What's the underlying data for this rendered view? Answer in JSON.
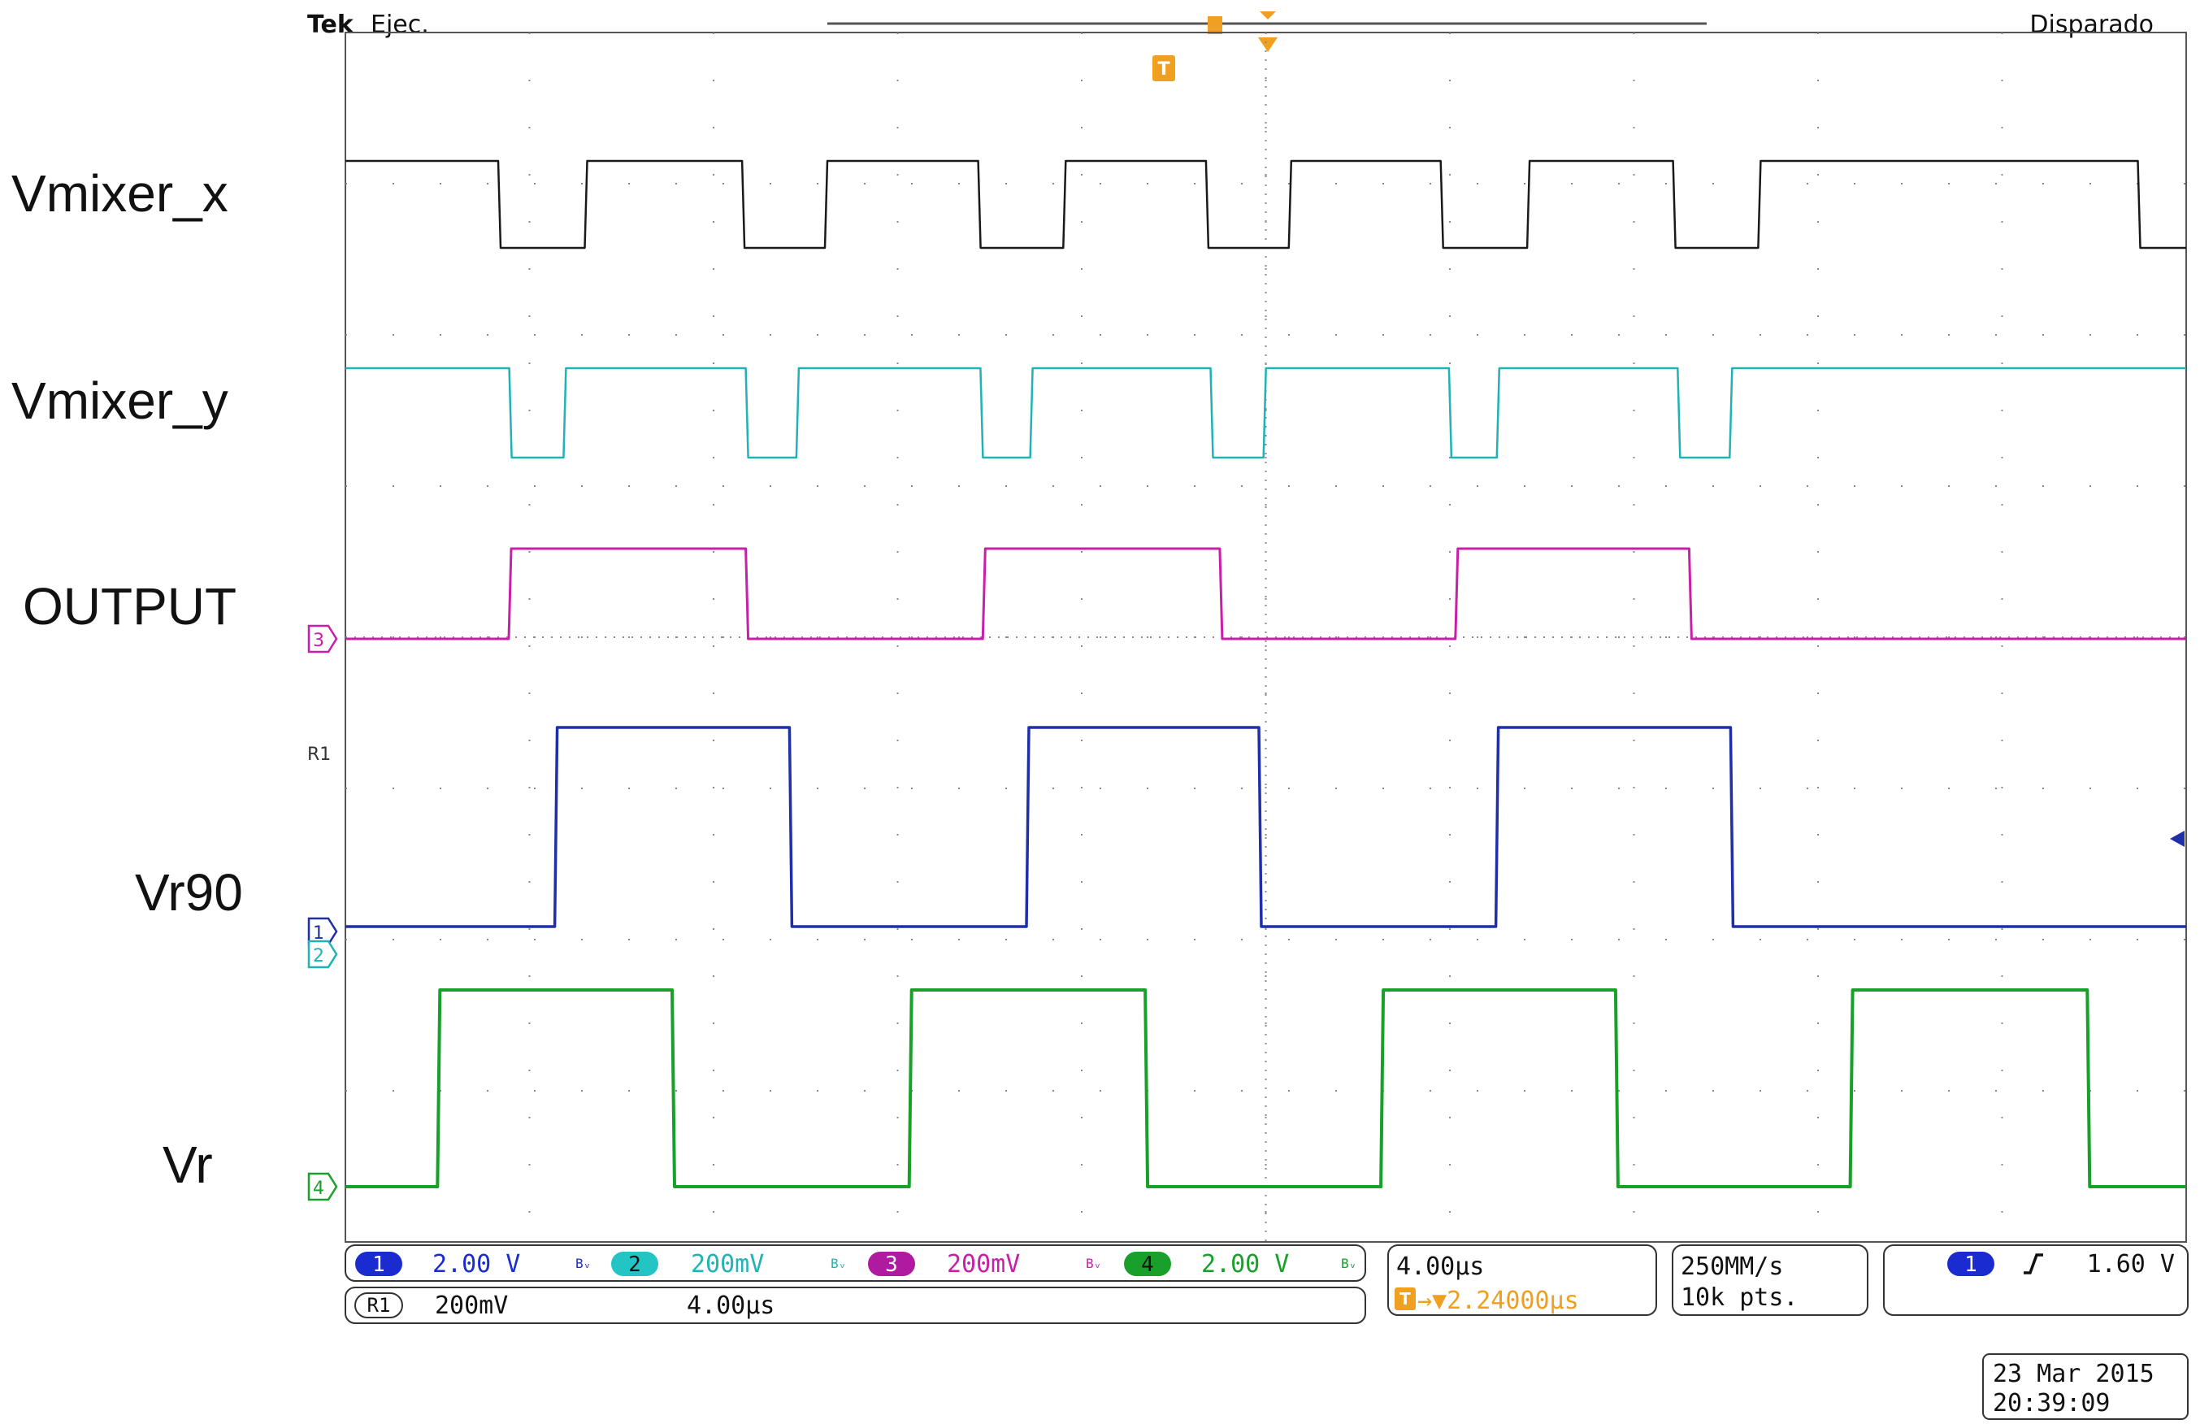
{
  "header": {
    "brand": "Tek",
    "run_state": "Ejec.",
    "trigger_status": "Disparado"
  },
  "side_labels": [
    "Vmixer_x",
    "Vmixer_y",
    "OUTPUT",
    "Vr90",
    "Vr"
  ],
  "channel_markers": {
    "ch1": "1",
    "ch2": "2",
    "ch3": "3",
    "ch4": "4",
    "ref": "R1"
  },
  "status_bar": {
    "ch1": {
      "num": "1",
      "scale": "2.00 V",
      "coupling": "Bᵥ"
    },
    "ch2": {
      "num": "2",
      "scale": "200mV",
      "coupling": "Bᵥ"
    },
    "ch3": {
      "num": "3",
      "scale": "200mV",
      "coupling": "Bᵥ"
    },
    "ch4": {
      "num": "4",
      "scale": "2.00 V",
      "coupling": "Bᵥ"
    },
    "ref": {
      "label": "R1",
      "scale": "200mV",
      "time": "4.00µs"
    },
    "timebase": "4.00µs",
    "trigger_position": "→▼2.24000µs",
    "sample_rate": "250MM/s",
    "record_length": "10k pts.",
    "trigger_channel": "1",
    "trigger_level": "1.60 V",
    "trigger_slope_icon": "rising-edge-icon"
  },
  "datetime": {
    "date": "23 Mar  2015",
    "time": "20:39:09"
  },
  "colors": {
    "vmixer_x": "#1a1a1a",
    "vmixer_y": "#1fb3b3",
    "output": "#c81fa8",
    "vr90": "#1f2fa8",
    "vr": "#18a02a",
    "trigger_marker": "#f0a020",
    "grid": "#8a8a8a"
  },
  "chart_data": {
    "type": "line",
    "title": "",
    "xlabel": "",
    "ylabel": "",
    "x_unit": "µs",
    "xlim": [
      0,
      40
    ],
    "x_divisions": 10,
    "y_divisions": 8,
    "grid": true,
    "series": [
      {
        "name": "Vmixer_x",
        "channel": "R1",
        "scale": "200mV/div",
        "high": 0.28,
        "low": -0.1,
        "start_level": "high",
        "edges": [
          3.32,
          5.2,
          8.62,
          10.42,
          13.75,
          15.6,
          18.7,
          20.5,
          23.8,
          25.68,
          28.85,
          30.7,
          38.95
        ]
      },
      {
        "name": "Vmixer_y",
        "channel": "2",
        "scale": "200mV/div",
        "high": 0.2,
        "low": -0.22,
        "start_level": "high",
        "edges": [
          3.56,
          4.74,
          8.7,
          9.8,
          13.8,
          14.88,
          18.8,
          19.95,
          23.98,
          25.02,
          28.95,
          30.08
        ]
      },
      {
        "name": "OUTPUT",
        "channel": "3",
        "scale": "200mV/div",
        "high": 0.4,
        "low": 0.0,
        "start_level": "low",
        "edges": [
          3.55,
          8.7,
          13.85,
          19.0,
          24.12,
          29.2
        ]
      },
      {
        "name": "Vr90",
        "channel": "1",
        "scale": "2.00 V/div",
        "high": 3.3,
        "low": 0.0,
        "start_level": "low",
        "edges": [
          4.55,
          9.65,
          14.8,
          19.85,
          25.0,
          30.1
        ]
      },
      {
        "name": "Vr",
        "channel": "4",
        "scale": "2.00 V/div",
        "high": 3.3,
        "low": 0.0,
        "start_level": "low",
        "edges": [
          2.0,
          7.1,
          12.25,
          17.38,
          22.5,
          27.6,
          32.7,
          37.85
        ]
      }
    ]
  }
}
